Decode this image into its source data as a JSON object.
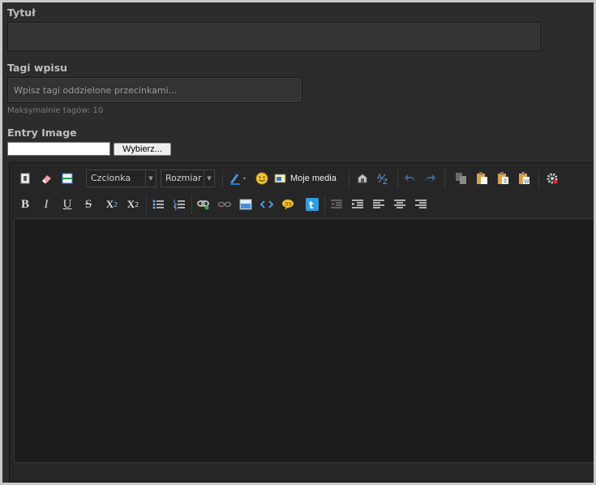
{
  "form": {
    "title_label": "Tytuł",
    "tags_label": "Tagi wpisu",
    "tags_placeholder": "Wpisz tagi oddzielone przecinkami...",
    "tags_hint": "Maksymalnie tagów: 10",
    "image_label": "Entry Image",
    "choose_button": "Wybierz..."
  },
  "toolbar": {
    "font_combo": "Czcionka",
    "size_combo": "Rozmiar",
    "media_button": "Moje media",
    "bold": "B",
    "italic": "I",
    "underline": "U",
    "strike": "S",
    "subscript": "X",
    "subscript_mark": "2",
    "superscript": "X",
    "superscript_mark": "2"
  },
  "colors": {
    "background": "#2c2c2c",
    "field": "#333333",
    "editor_area": "#1c1c1c",
    "accent_blue": "#2f8ed8"
  },
  "icons": [
    "source-icon",
    "eraser-icon",
    "hr-icon",
    "font-color-icon",
    "smiley-icon",
    "media-icon",
    "anchor-icon",
    "spellcheck-icon",
    "undo-icon",
    "redo-icon",
    "copy-icon",
    "paste-icon",
    "paste-text-icon",
    "paste-word-icon",
    "settings-icon",
    "bullet-list-icon",
    "numbered-list-icon",
    "link-icon",
    "unlink-icon",
    "image-icon",
    "code-icon",
    "quote-icon",
    "twitter-icon",
    "outdent-icon",
    "indent-icon",
    "align-left-icon",
    "align-center-icon",
    "align-right-icon"
  ]
}
